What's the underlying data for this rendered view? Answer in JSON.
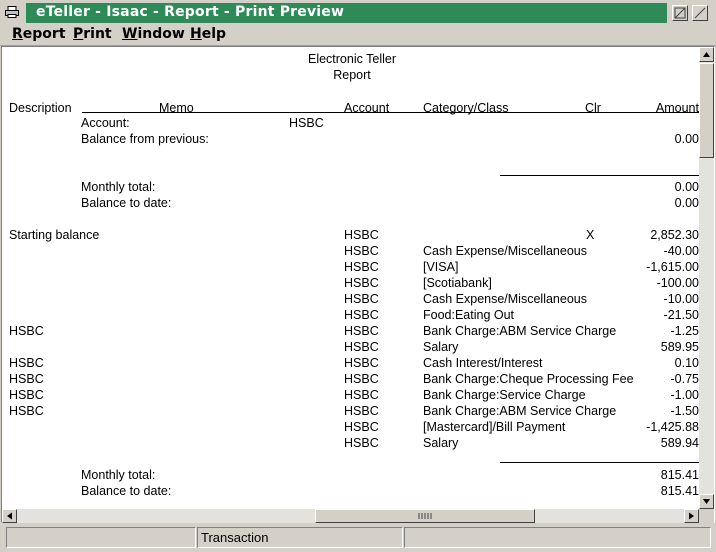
{
  "window": {
    "title": "eTeller - Isaac - Report - Print Preview"
  },
  "menu": {
    "items": [
      {
        "mnemonic": "R",
        "rest": "eport"
      },
      {
        "mnemonic": "P",
        "rest": "rint"
      },
      {
        "mnemonic": "W",
        "rest": "indow"
      },
      {
        "mnemonic": "H",
        "rest": "elp"
      }
    ]
  },
  "report": {
    "heading_line1": "Electronic Teller",
    "heading_line2": "Report",
    "columns": {
      "description": "Description",
      "memo": "Memo",
      "account": "Account",
      "category": "Category/Class",
      "clr": "Clr",
      "amount": "Amount"
    },
    "account_label": "Account:",
    "account_name": "HSBC",
    "balance_previous_label": "Balance from previous:",
    "balance_previous_amount": "0.00",
    "summary1": {
      "monthly_total_label": "Monthly total:",
      "monthly_total_amount": "0.00",
      "balance_to_date_label": "Balance to date:",
      "balance_to_date_amount": "0.00"
    },
    "transactions": [
      {
        "description": "Starting balance",
        "account": "HSBC",
        "category": "",
        "clr": "X",
        "amount": "2,852.30"
      },
      {
        "description": "",
        "account": "HSBC",
        "category": "Cash Expense/Miscellaneous",
        "clr": "",
        "amount": "-40.00"
      },
      {
        "description": "",
        "account": "HSBC",
        "category": "[VISA]",
        "clr": "",
        "amount": "-1,615.00"
      },
      {
        "description": "",
        "account": "HSBC",
        "category": "[Scotiabank]",
        "clr": "",
        "amount": "-100.00"
      },
      {
        "description": "",
        "account": "HSBC",
        "category": "Cash Expense/Miscellaneous",
        "clr": "",
        "amount": "-10.00"
      },
      {
        "description": "",
        "account": "HSBC",
        "category": "Food:Eating Out",
        "clr": "",
        "amount": "-21.50"
      },
      {
        "description": "HSBC",
        "account": "HSBC",
        "category": "Bank Charge:ABM Service Charge",
        "clr": "",
        "amount": "-1.25"
      },
      {
        "description": "",
        "account": "HSBC",
        "category": "Salary",
        "clr": "",
        "amount": "589.95"
      },
      {
        "description": "HSBC",
        "account": "HSBC",
        "category": "Cash Interest/Interest",
        "clr": "",
        "amount": "0.10"
      },
      {
        "description": "HSBC",
        "account": "HSBC",
        "category": "Bank Charge:Cheque Processing Fee",
        "clr": "",
        "amount": "-0.75"
      },
      {
        "description": "HSBC",
        "account": "HSBC",
        "category": "Bank Charge:Service Charge",
        "clr": "",
        "amount": "-1.00"
      },
      {
        "description": "HSBC",
        "account": "HSBC",
        "category": "Bank Charge:ABM Service Charge",
        "clr": "",
        "amount": "-1.50"
      },
      {
        "description": "",
        "account": "HSBC",
        "category": "[Mastercard]/Bill Payment",
        "clr": "",
        "amount": "-1,425.88"
      },
      {
        "description": "",
        "account": "HSBC",
        "category": "Salary",
        "clr": "",
        "amount": "589.94"
      }
    ],
    "summary2": {
      "monthly_total_label": "Monthly total:",
      "monthly_total_amount": "815.41",
      "balance_to_date_label": "Balance to date:",
      "balance_to_date_amount": "815.41"
    }
  },
  "status": {
    "pane1": "",
    "pane2": "Transaction",
    "pane3": ""
  },
  "colors": {
    "titlebar": "#2e8b57",
    "chrome": "#d4d0c8"
  }
}
